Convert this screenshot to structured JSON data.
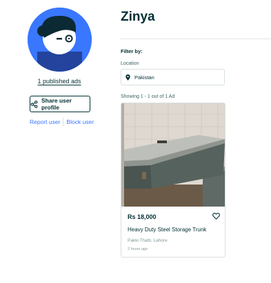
{
  "profile": {
    "published_ads_label": "1 published ads",
    "share_label": "Share user profile",
    "report_label": "Report user",
    "block_label": "Block user"
  },
  "user": {
    "name": "Zinya"
  },
  "filters": {
    "heading": "Filter by:",
    "location_label": "Location",
    "location_value": "Pakistan"
  },
  "results": {
    "summary": "Showing 1 - 1 out of 1 Ad"
  },
  "ads": [
    {
      "price": "Rs 18,000",
      "title": "Heavy Duty Steel Storage Trunk",
      "location": "Pakki Thatti, Lahore",
      "time": "2 hours ago"
    }
  ],
  "icons": {
    "avatar": "user-avatar-icon",
    "share": "share-icon",
    "location": "location-pin-icon",
    "favorite": "heart-icon"
  },
  "colors": {
    "accent": "#3a77ff",
    "text": "#002f34",
    "muted": "#7f9799",
    "border": "#d8dfe0"
  }
}
